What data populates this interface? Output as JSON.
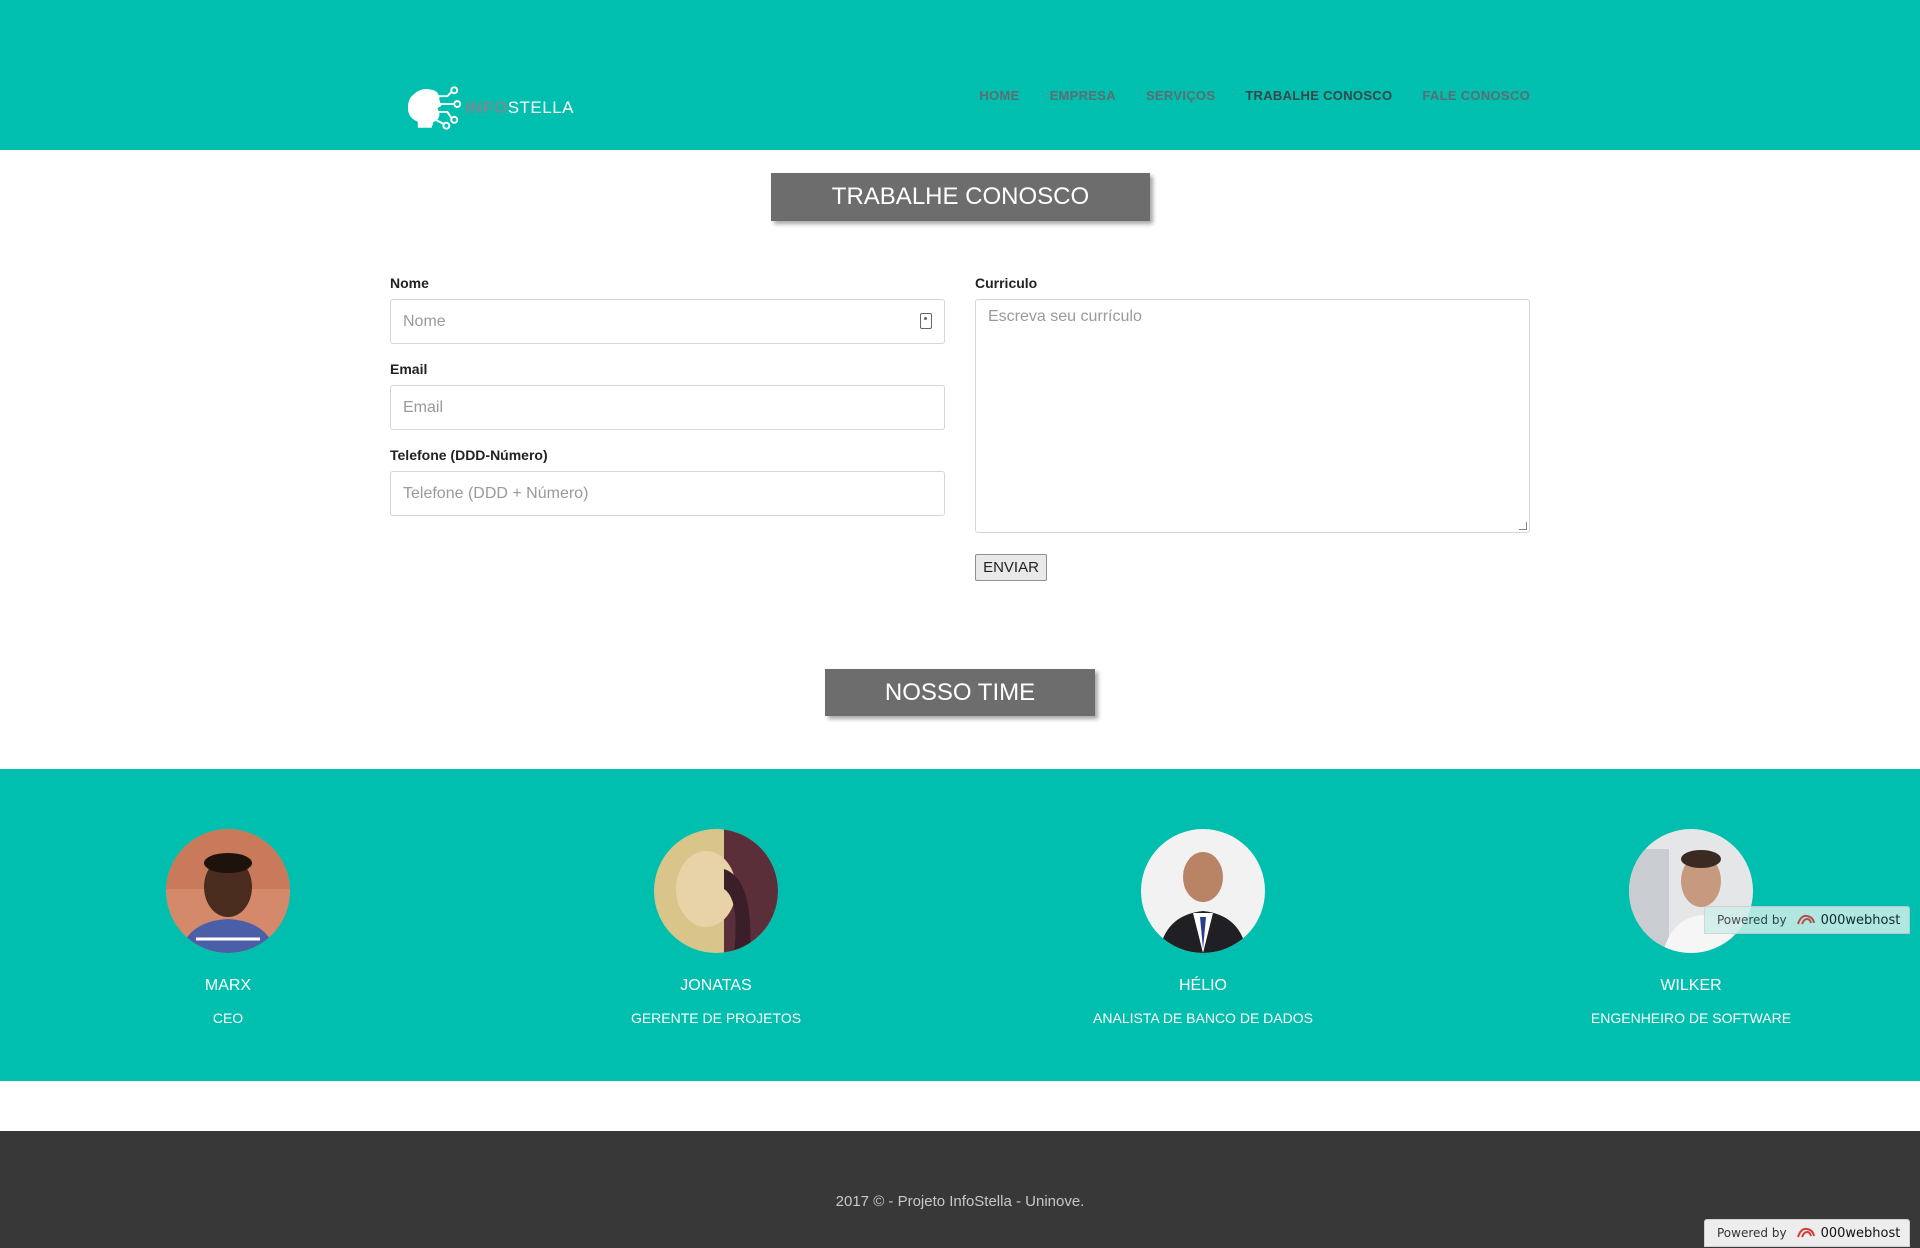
{
  "header": {
    "logo": {
      "part1": "INFO",
      "part2": "STELLA"
    },
    "nav": [
      {
        "label": "HOME",
        "active": false
      },
      {
        "label": "EMPRESA",
        "active": false
      },
      {
        "label": "SERVIÇOS",
        "active": false
      },
      {
        "label": "TRABALHE CONOSCO",
        "active": true
      },
      {
        "label": "FALE CONOSCO",
        "active": false
      }
    ]
  },
  "form_section": {
    "title": "TRABALHE CONOSCO",
    "nome": {
      "label": "Nome",
      "placeholder": "Nome",
      "value": ""
    },
    "email": {
      "label": "Email",
      "placeholder": "Email",
      "value": ""
    },
    "telefone": {
      "label": "Telefone (DDD-Número)",
      "placeholder": "Telefone (DDD + Número)",
      "value": ""
    },
    "curriculo": {
      "label": "Curriculo",
      "placeholder": "Escreva seu currículo",
      "value": ""
    },
    "submit_label": "ENVIAR"
  },
  "team_section": {
    "title": "NOSSO TIME",
    "members": [
      {
        "name": "MARX",
        "role": "CEO"
      },
      {
        "name": "JONATAS",
        "role": "GERENTE DE PROJETOS"
      },
      {
        "name": "HÉLIO",
        "role": "ANALISTA DE BANCO DE DADOS"
      },
      {
        "name": "WILKER",
        "role": "ENGENHEIRO DE SOFTWARE"
      }
    ]
  },
  "footer": {
    "text": "2017 © - Projeto InfoStella - Uninove."
  },
  "badge": {
    "powered_by": "Powered by",
    "host": "000webhost"
  },
  "colors": {
    "accent": "#00bfae",
    "title_bg": "#6d6d6d",
    "footer_bg": "#383838"
  }
}
